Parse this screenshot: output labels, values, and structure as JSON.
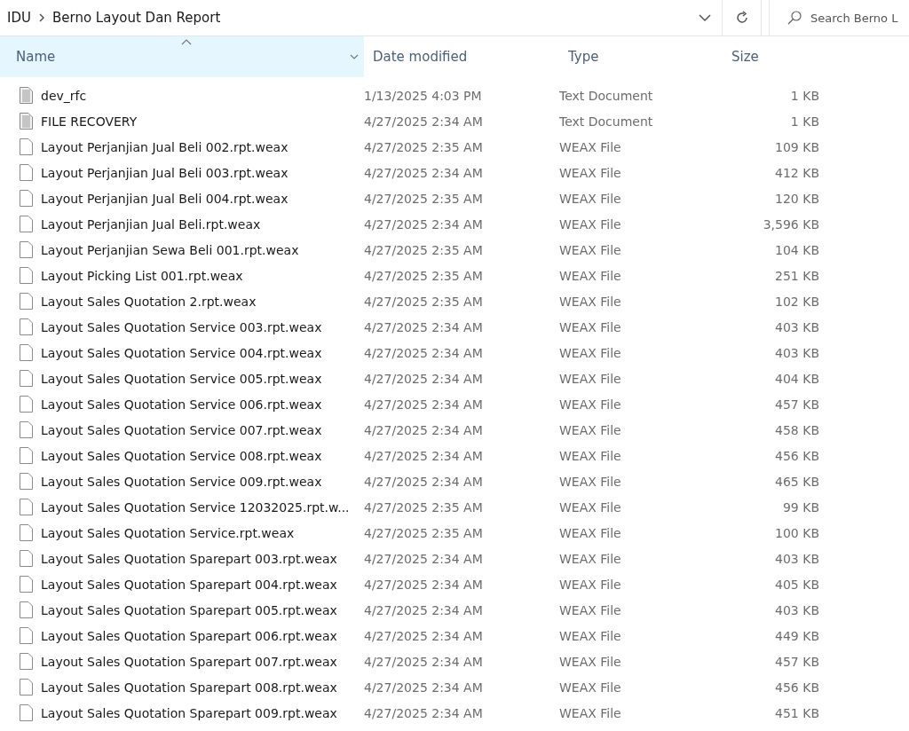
{
  "breadcrumb": [
    "IDU",
    "Berno Layout Dan Report"
  ],
  "search": {
    "placeholder": "Search Berno L"
  },
  "columns": [
    {
      "label": "Name",
      "sorted": true
    },
    {
      "label": "Date modified",
      "sorted": false
    },
    {
      "label": "Type",
      "sorted": false
    },
    {
      "label": "Size",
      "sorted": false
    }
  ],
  "files": [
    {
      "kind": "text",
      "name": "dev_rfc",
      "date": "1/13/2025 4:03 PM",
      "type": "Text Document",
      "size": "1 KB"
    },
    {
      "kind": "text",
      "name": "FILE RECOVERY",
      "date": "4/27/2025 2:34 AM",
      "type": "Text Document",
      "size": "1 KB"
    },
    {
      "kind": "blank",
      "name": "Layout Perjanjian Jual Beli 002.rpt.weax",
      "date": "4/27/2025 2:35 AM",
      "type": "WEAX File",
      "size": "109 KB"
    },
    {
      "kind": "blank",
      "name": "Layout Perjanjian Jual Beli 003.rpt.weax",
      "date": "4/27/2025 2:34 AM",
      "type": "WEAX File",
      "size": "412 KB"
    },
    {
      "kind": "blank",
      "name": "Layout Perjanjian Jual Beli 004.rpt.weax",
      "date": "4/27/2025 2:35 AM",
      "type": "WEAX File",
      "size": "120 KB"
    },
    {
      "kind": "blank",
      "name": "Layout Perjanjian Jual Beli.rpt.weax",
      "date": "4/27/2025 2:34 AM",
      "type": "WEAX File",
      "size": "3,596 KB"
    },
    {
      "kind": "blank",
      "name": "Layout Perjanjian Sewa Beli 001.rpt.weax",
      "date": "4/27/2025 2:35 AM",
      "type": "WEAX File",
      "size": "104 KB"
    },
    {
      "kind": "blank",
      "name": "Layout Picking List 001.rpt.weax",
      "date": "4/27/2025 2:35 AM",
      "type": "WEAX File",
      "size": "251 KB"
    },
    {
      "kind": "blank",
      "name": "Layout Sales Quotation 2.rpt.weax",
      "date": "4/27/2025 2:35 AM",
      "type": "WEAX File",
      "size": "102 KB"
    },
    {
      "kind": "blank",
      "name": "Layout Sales Quotation Service 003.rpt.weax",
      "date": "4/27/2025 2:34 AM",
      "type": "WEAX File",
      "size": "403 KB"
    },
    {
      "kind": "blank",
      "name": "Layout Sales Quotation Service 004.rpt.weax",
      "date": "4/27/2025 2:34 AM",
      "type": "WEAX File",
      "size": "403 KB"
    },
    {
      "kind": "blank",
      "name": "Layout Sales Quotation Service 005.rpt.weax",
      "date": "4/27/2025 2:34 AM",
      "type": "WEAX File",
      "size": "404 KB"
    },
    {
      "kind": "blank",
      "name": "Layout Sales Quotation Service 006.rpt.weax",
      "date": "4/27/2025 2:34 AM",
      "type": "WEAX File",
      "size": "457 KB"
    },
    {
      "kind": "blank",
      "name": "Layout Sales Quotation Service 007.rpt.weax",
      "date": "4/27/2025 2:34 AM",
      "type": "WEAX File",
      "size": "458 KB"
    },
    {
      "kind": "blank",
      "name": "Layout Sales Quotation Service 008.rpt.weax",
      "date": "4/27/2025 2:34 AM",
      "type": "WEAX File",
      "size": "456 KB"
    },
    {
      "kind": "blank",
      "name": "Layout Sales Quotation Service 009.rpt.weax",
      "date": "4/27/2025 2:34 AM",
      "type": "WEAX File",
      "size": "465 KB"
    },
    {
      "kind": "blank",
      "name": "Layout Sales Quotation Service 12032025.rpt.w...",
      "date": "4/27/2025 2:35 AM",
      "type": "WEAX File",
      "size": "99 KB"
    },
    {
      "kind": "blank",
      "name": "Layout Sales Quotation Service.rpt.weax",
      "date": "4/27/2025 2:35 AM",
      "type": "WEAX File",
      "size": "100 KB"
    },
    {
      "kind": "blank",
      "name": "Layout Sales Quotation Sparepart 003.rpt.weax",
      "date": "4/27/2025 2:34 AM",
      "type": "WEAX File",
      "size": "403 KB"
    },
    {
      "kind": "blank",
      "name": "Layout Sales Quotation Sparepart 004.rpt.weax",
      "date": "4/27/2025 2:34 AM",
      "type": "WEAX File",
      "size": "405 KB"
    },
    {
      "kind": "blank",
      "name": "Layout Sales Quotation Sparepart 005.rpt.weax",
      "date": "4/27/2025 2:34 AM",
      "type": "WEAX File",
      "size": "403 KB"
    },
    {
      "kind": "blank",
      "name": "Layout Sales Quotation Sparepart 006.rpt.weax",
      "date": "4/27/2025 2:34 AM",
      "type": "WEAX File",
      "size": "449 KB"
    },
    {
      "kind": "blank",
      "name": "Layout Sales Quotation Sparepart 007.rpt.weax",
      "date": "4/27/2025 2:34 AM",
      "type": "WEAX File",
      "size": "457 KB"
    },
    {
      "kind": "blank",
      "name": "Layout Sales Quotation Sparepart 008.rpt.weax",
      "date": "4/27/2025 2:34 AM",
      "type": "WEAX File",
      "size": "456 KB"
    },
    {
      "kind": "blank",
      "name": "Layout Sales Quotation Sparepart 009.rpt.weax",
      "date": "4/27/2025 2:34 AM",
      "type": "WEAX File",
      "size": "451 KB"
    }
  ]
}
